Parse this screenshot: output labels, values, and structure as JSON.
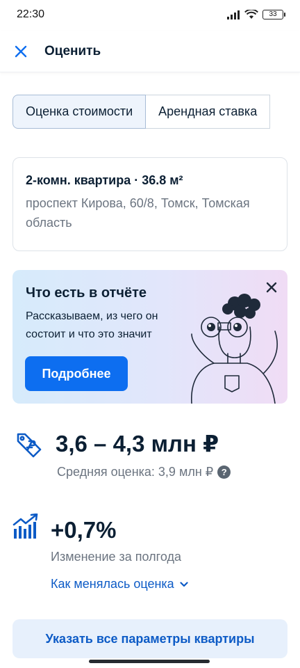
{
  "status_bar": {
    "time": "22:30",
    "battery": "33"
  },
  "header": {
    "title": "Оценить",
    "close_icon": "close-icon"
  },
  "tabs": [
    {
      "label": "Оценка стоимости",
      "active": true
    },
    {
      "label": "Арендная ставка",
      "active": false
    }
  ],
  "property": {
    "title": "2-комн. квартира · 36.8 м²",
    "address": "проспект Кирова, 60/8, Томск, Томская область"
  },
  "promo": {
    "title": "Что есть в отчёте",
    "text": "Рассказываем, из чего он состоит и что это значит",
    "button_label": "Подробнее",
    "illustration": "person-with-binoculars"
  },
  "estimate": {
    "range": "3,6 – 4,3 млн ₽",
    "average": "Средняя оценка: 3,9 млн ₽",
    "help": "?"
  },
  "change": {
    "value": "+0,7%",
    "caption": "Изменение за полгода",
    "link_label": "Как менялась оценка"
  },
  "footer": {
    "params_button": "Указать все параметры квартиры"
  },
  "colors": {
    "accent": "#0d6ef0",
    "link": "#0d5bc6",
    "text": "#0b1f33",
    "muted": "#6b7480"
  }
}
